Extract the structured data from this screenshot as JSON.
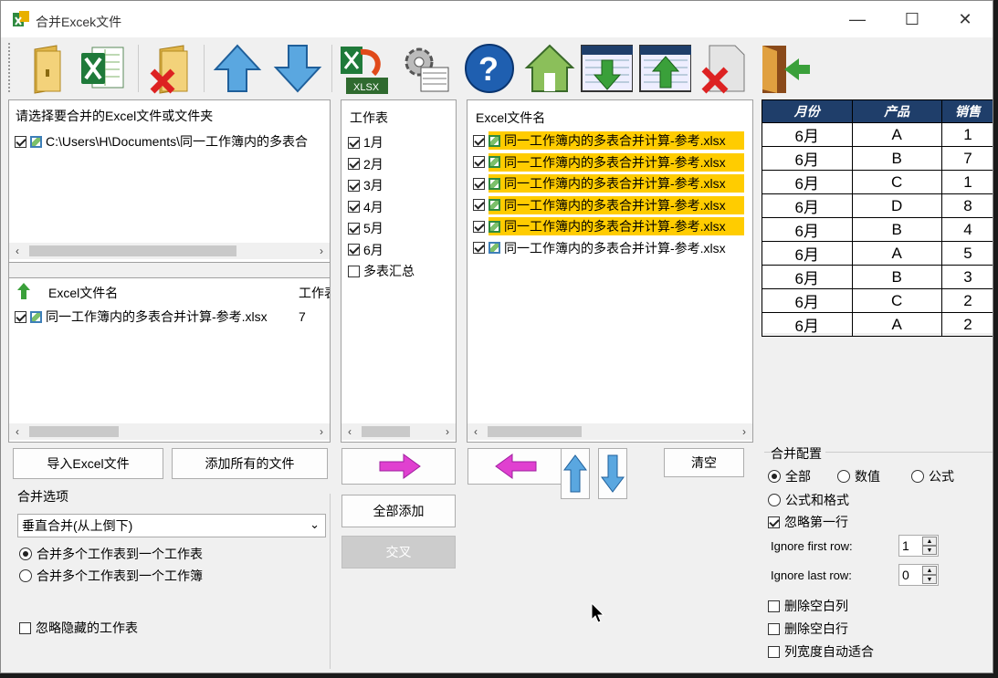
{
  "window": {
    "title": "合并Excek文件",
    "minimize": "—",
    "maximize": "☐",
    "close": "✕"
  },
  "toolbar": {
    "items": [
      "open-folder-icon",
      "excel-icon",
      "delete-folder-icon",
      "move-up-icon",
      "move-down-icon",
      "merge-xlsx-icon",
      "settings-icon",
      "help-icon",
      "home-icon",
      "import-down-icon",
      "export-up-icon",
      "delete-file-icon",
      "exit-icon"
    ]
  },
  "files_panel": {
    "header": "请选择要合并的Excel文件或文件夹",
    "folder_path": "C:\\Users\\H\\Documents\\同一工作簿内的多表合"
  },
  "file_list": {
    "col_name": "Excel文件名",
    "col_sheets": "工作表",
    "file_name": "同一工作簿内的多表合并计算-参考.xlsx",
    "file_sheets": "7"
  },
  "sheets_panel": {
    "header": "工作表",
    "items": [
      {
        "label": "1月",
        "checked": true
      },
      {
        "label": "2月",
        "checked": true
      },
      {
        "label": "3月",
        "checked": true
      },
      {
        "label": "4月",
        "checked": true
      },
      {
        "label": "5月",
        "checked": true
      },
      {
        "label": "6月",
        "checked": true
      },
      {
        "label": "多表汇总",
        "checked": false
      }
    ]
  },
  "selected_panel": {
    "header": "Excel文件名",
    "items": [
      {
        "label": "同一工作簿内的多表合并计算-参考.xlsx",
        "highlight": true
      },
      {
        "label": "同一工作簿内的多表合并计算-参考.xlsx",
        "highlight": true
      },
      {
        "label": "同一工作簿内的多表合并计算-参考.xlsx",
        "highlight": true
      },
      {
        "label": "同一工作簿内的多表合并计算-参考.xlsx",
        "highlight": true
      },
      {
        "label": "同一工作簿内的多表合并计算-参考.xlsx",
        "highlight": true
      },
      {
        "label": "同一工作簿内的多表合并计算-参考.xlsx",
        "highlight": false
      }
    ]
  },
  "preview": {
    "headers": [
      "月份",
      "产品",
      "销售"
    ],
    "rows": [
      [
        "6月",
        "A",
        "1"
      ],
      [
        "6月",
        "B",
        "7"
      ],
      [
        "6月",
        "C",
        "1"
      ],
      [
        "6月",
        "D",
        "8"
      ],
      [
        "6月",
        "B",
        "4"
      ],
      [
        "6月",
        "A",
        "5"
      ],
      [
        "6月",
        "B",
        "3"
      ],
      [
        "6月",
        "C",
        "2"
      ],
      [
        "6月",
        "A",
        "2"
      ]
    ]
  },
  "buttons": {
    "import_excel": "导入Excel文件",
    "add_all_files": "添加所有的文件",
    "add_all": "全部添加",
    "cross": "交叉",
    "clear": "清空"
  },
  "merge_options": {
    "title": "合并选项",
    "mode_value": "垂直合并(从上倒下)",
    "radio_sheet": "合并多个工作表到一个工作表",
    "radio_book": "合并多个工作表到一个工作簿",
    "ignore_hidden": "忽略隐藏的工作表"
  },
  "merge_config": {
    "title": "合并配置",
    "all": "全部",
    "values": "数值",
    "formula": "公式",
    "formula_format": "公式和格式",
    "ignore_first": "忽略第一行",
    "ignore_first_row_label": "Ignore first row:",
    "ignore_first_row_value": "1",
    "ignore_last_row_label": "Ignore last row:",
    "ignore_last_row_value": "0",
    "delete_blank_cols": "删除空白列",
    "delete_blank_rows": "删除空白行",
    "autofit": "列宽度自动适合"
  }
}
